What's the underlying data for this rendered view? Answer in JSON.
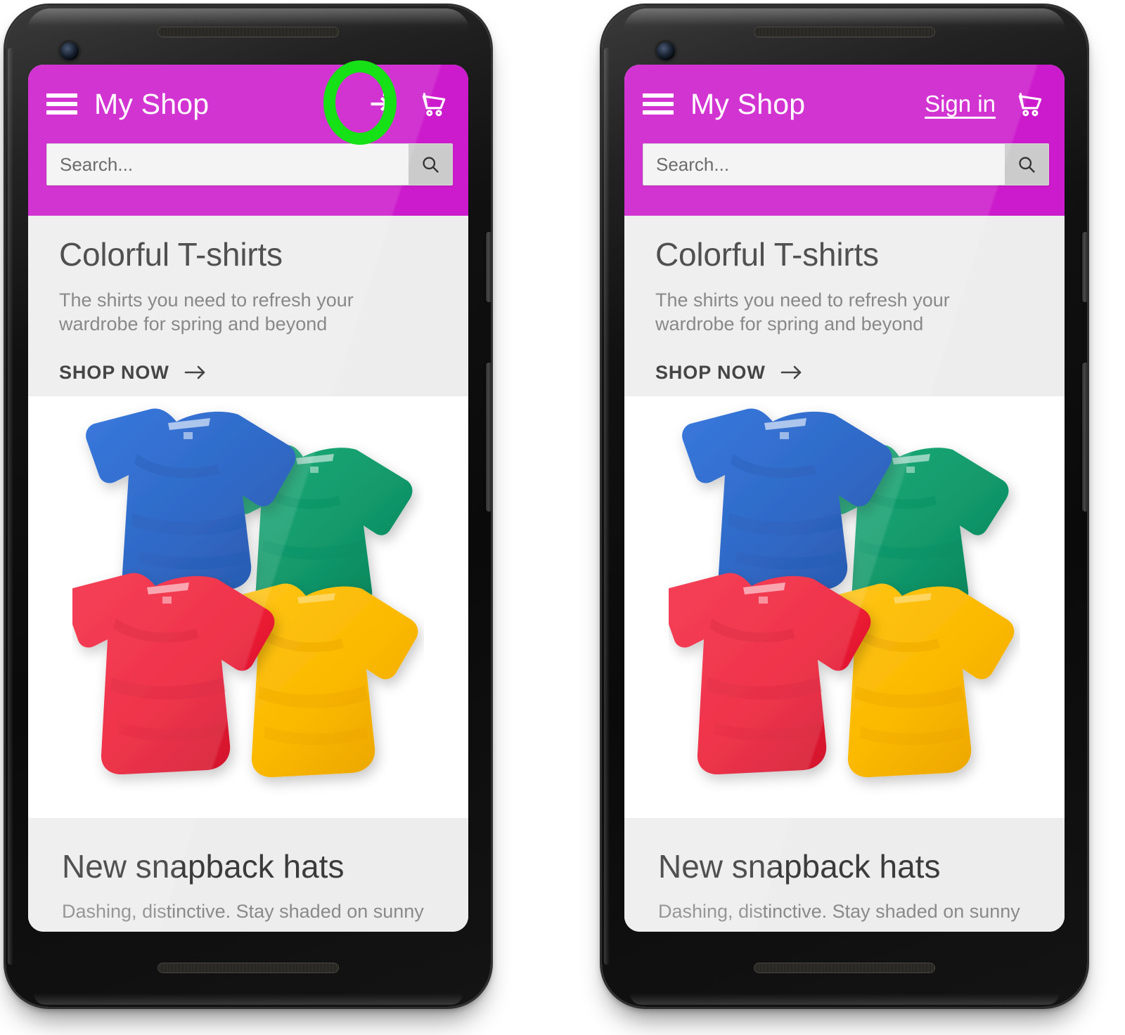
{
  "page": {
    "title": "My Shop mobile app — sign in affordance comparison",
    "highlight_color": "#16e016",
    "brand_color": "#cc1bcc",
    "phone_count": 2
  },
  "app": {
    "title": "My Shop",
    "menu_icon": "hamburger-menu-icon",
    "cart_icon": "shopping-cart-icon",
    "login_icon": "login-arrow-icon",
    "signin_label": "Sign in",
    "search": {
      "placeholder": "Search...",
      "value": "",
      "button_icon": "search-magnifier-icon"
    }
  },
  "hero": {
    "title": "Colorful T-shirts",
    "subtitle": "The shirts you need to refresh your wardrobe for spring and beyond",
    "cta_label": "SHOP NOW",
    "cta_icon": "arrow-right-icon",
    "image_alt": "Four folded t-shirts",
    "shirt_colors": [
      {
        "name": "blue",
        "hex": "#1557c0"
      },
      {
        "name": "green",
        "hex": "#12996b"
      },
      {
        "name": "red",
        "hex": "#ed1b34"
      },
      {
        "name": "yellow",
        "hex": "#fbb901"
      }
    ]
  },
  "section2": {
    "title": "New snapback hats",
    "subtitle": "Dashing, distinctive. Stay shaded on sunny"
  },
  "variants": [
    {
      "id": "left",
      "action_type": "icon",
      "description": "Sign-in shown as a login arrow icon"
    },
    {
      "id": "right",
      "action_type": "text",
      "description": "Sign-in shown as an underlined text link"
    }
  ]
}
